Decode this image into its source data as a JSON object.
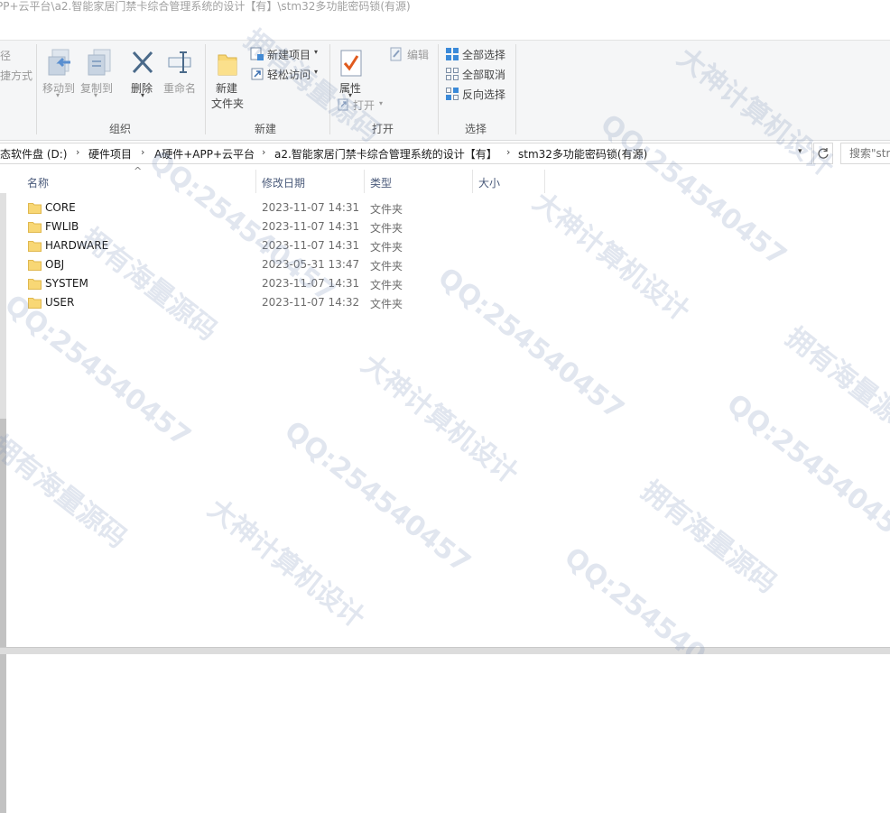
{
  "window": {
    "title": "PP+云平台\\a2.智能家居门禁卡综合管理系统的设计【有】\\stm32多功能密码锁(有源)"
  },
  "ribbon": {
    "clipboard": {
      "partial_1": "径",
      "partial_2": "捷方式"
    },
    "organize": {
      "move_to": "移动到",
      "copy_to": "复制到",
      "delete": "删除",
      "rename": "重命名",
      "group_label": "组织"
    },
    "new": {
      "new_folder_line1": "新建",
      "new_folder_line2": "文件夹",
      "new_item": "新建项目",
      "easy_access": "轻松访问",
      "group_label": "新建"
    },
    "open": {
      "properties": "属性",
      "open": "打开",
      "edit": "编辑",
      "group_label": "打开"
    },
    "select": {
      "select_all": "全部选择",
      "select_none": "全部取消",
      "invert_selection": "反向选择",
      "group_label": "选择"
    }
  },
  "address_bar": {
    "crumbs": [
      "态软件盘 (D:)",
      "硬件项目",
      "A硬件+APP+云平台",
      "a2.智能家居门禁卡综合管理系统的设计【有】",
      "stm32多功能密码锁(有源)"
    ],
    "search_placeholder": "搜索\"stm"
  },
  "columns": {
    "name": "名称",
    "modified": "修改日期",
    "type": "类型",
    "size": "大小"
  },
  "files": [
    {
      "name": "CORE",
      "modified": "2023-11-07 14:31",
      "type": "文件夹"
    },
    {
      "name": "FWLIB",
      "modified": "2023-11-07 14:31",
      "type": "文件夹"
    },
    {
      "name": "HARDWARE",
      "modified": "2023-11-07 14:31",
      "type": "文件夹"
    },
    {
      "name": "OBJ",
      "modified": "2023-05-31 13:47",
      "type": "文件夹"
    },
    {
      "name": "SYSTEM",
      "modified": "2023-11-07 14:31",
      "type": "文件夹"
    },
    {
      "name": "USER",
      "modified": "2023-11-07 14:32",
      "type": "文件夹"
    }
  ],
  "watermarks": [
    "大神计算机设计",
    "QQ:254540457",
    "拥有海量源码"
  ],
  "colors": {
    "folder": "#f8d775",
    "accent": "#1f6fc5",
    "delete_x": "#4a6a8a",
    "check": "#e05a1e"
  }
}
